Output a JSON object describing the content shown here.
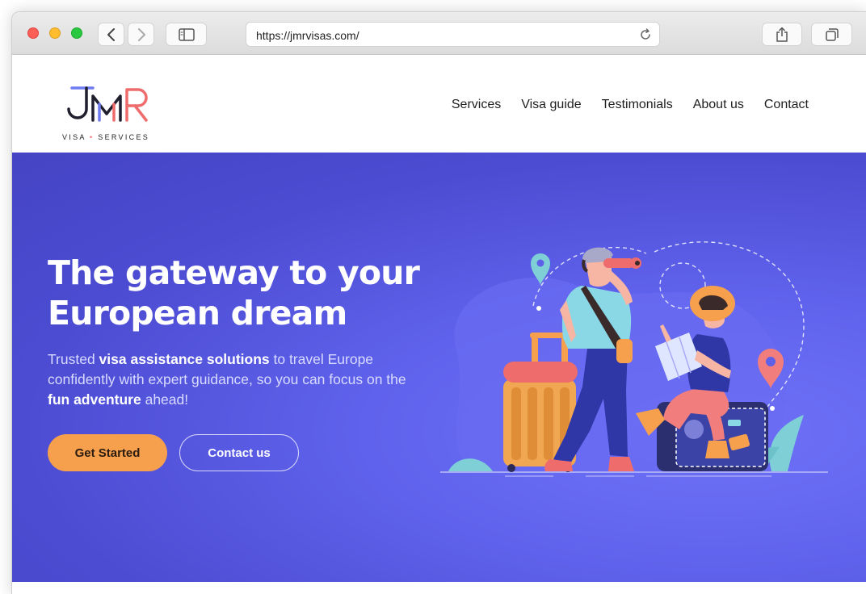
{
  "browser": {
    "url": "https://jmrvisas.com/"
  },
  "site": {
    "logo_text": "JMR",
    "logo_tagline_left": "VISA",
    "logo_tagline_dot": "•",
    "logo_tagline_right": "SERVICES",
    "nav": [
      {
        "label": "Services"
      },
      {
        "label": "Visa guide"
      },
      {
        "label": "Testimonials"
      },
      {
        "label": "About us"
      },
      {
        "label": "Contact"
      }
    ]
  },
  "hero": {
    "title": "The gateway to your European dream",
    "desc_part1": "Trusted ",
    "desc_bold1": "visa assistance solutions",
    "desc_part2": " to travel Europe confidently with expert guidance, so you can focus on the ",
    "desc_bold2": "fun adventure",
    "desc_part3": " ahead!",
    "primary_button": "Get Started",
    "secondary_button": "Contact us"
  },
  "colors": {
    "hero_bg": "#4c4cd2",
    "accent_orange": "#f6a04d",
    "logo_blue": "#6f7cf0",
    "logo_red": "#ef6c6c"
  },
  "icons": {
    "back": "chevron-left-icon",
    "forward": "chevron-right-icon",
    "sidebar": "sidebar-icon",
    "reload": "reload-icon",
    "share": "share-icon",
    "tabs": "tabs-icon"
  }
}
